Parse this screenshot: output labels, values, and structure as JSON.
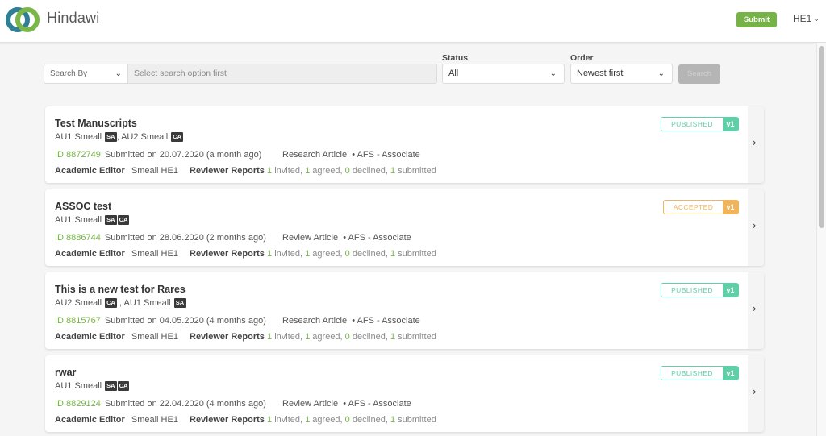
{
  "header": {
    "brand": "Hindawi",
    "submit_label": "Submit",
    "user_label": "HE1"
  },
  "filters": {
    "search_by_label": "Search By",
    "search_placeholder": "Select search option first",
    "status_label": "Status",
    "status_value": "All",
    "order_label": "Order",
    "order_value": "Newest first",
    "search_button": "Search"
  },
  "colors": {
    "accent_green": "#76b347",
    "published": "#5fcfa7",
    "accepted": "#f2b45a"
  },
  "manuscripts": [
    {
      "title": "Test Manuscripts",
      "authors": [
        {
          "name": "AU1 Smeall",
          "tags": [
            "SA"
          ],
          "sep": ", "
        },
        {
          "name": "AU2 Smeall",
          "tags": [
            "CA"
          ],
          "sep": ""
        }
      ],
      "id": "ID 8872749",
      "submitted": "Submitted on 20.07.2020 (a month ago)",
      "article_type": "Research Article",
      "section": "AFS - Associate",
      "editor_label": "Academic Editor",
      "editor_name": "Smeall HE1",
      "reports_label": "Reviewer Reports",
      "invited": "1",
      "agreed": "1",
      "declined": "0",
      "submitted_count": "1",
      "status": "PUBLISHED",
      "version": "v1"
    },
    {
      "title": "ASSOC test",
      "authors": [
        {
          "name": "AU1 Smeall",
          "tags": [
            "SA",
            "CA"
          ],
          "sep": ""
        }
      ],
      "id": "ID 8886744",
      "submitted": "Submitted on 28.06.2020 (2 months ago)",
      "article_type": "Review Article",
      "section": "AFS - Associate",
      "editor_label": "Academic Editor",
      "editor_name": "Smeall HE1",
      "reports_label": "Reviewer Reports",
      "invited": "1",
      "agreed": "1",
      "declined": "0",
      "submitted_count": "1",
      "status": "ACCEPTED",
      "version": "v1"
    },
    {
      "title": "This is a new test for Rares",
      "authors": [
        {
          "name": "AU2 Smeall",
          "tags": [
            "CA"
          ],
          "sep": " , "
        },
        {
          "name": "AU1 Smeall",
          "tags": [
            "SA"
          ],
          "sep": ""
        }
      ],
      "id": "ID 8815767",
      "submitted": "Submitted on 04.05.2020 (4 months ago)",
      "article_type": "Research Article",
      "section": "AFS - Associate",
      "editor_label": "Academic Editor",
      "editor_name": "Smeall HE1",
      "reports_label": "Reviewer Reports",
      "invited": "1",
      "agreed": "1",
      "declined": "0",
      "submitted_count": "1",
      "status": "PUBLISHED",
      "version": "v1"
    },
    {
      "title": "rwar",
      "authors": [
        {
          "name": "AU1 Smeall",
          "tags": [
            "SA",
            "CA"
          ],
          "sep": ""
        }
      ],
      "id": "ID 8829124",
      "submitted": "Submitted on 22.04.2020 (4 months ago)",
      "article_type": "Review Article",
      "section": "AFS - Associate",
      "editor_label": "Academic Editor",
      "editor_name": "Smeall HE1",
      "reports_label": "Reviewer Reports",
      "invited": "1",
      "agreed": "1",
      "declined": "0",
      "submitted_count": "1",
      "status": "PUBLISHED",
      "version": "v1"
    }
  ],
  "labels": {
    "invited": "invited,",
    "agreed": "agreed,",
    "declined": "declined,",
    "submitted": "submitted",
    "bullet": "•"
  },
  "icons": {
    "logo": "hindawi-logo-icon",
    "chevron_down": "chevron-down-icon",
    "chevron_right": "chevron-right-icon"
  }
}
